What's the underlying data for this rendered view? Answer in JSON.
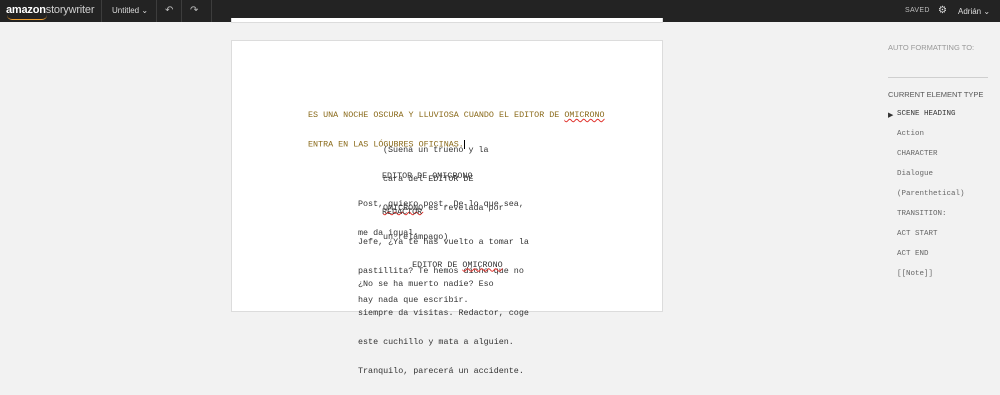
{
  "topbar": {
    "logo_bold": "amazon",
    "logo_light": "storywriter",
    "title_label": "Untitled",
    "title_caret": "⌄",
    "undo_icon": "↶",
    "redo_icon": "↷",
    "status": "SAVED",
    "settings_icon": "⚙",
    "user_name": "Adrián",
    "user_caret": "⌄"
  },
  "script": {
    "scene": [
      "ES UNA NOCHE OSCURA Y LLUVIOSA CUANDO EL EDITOR DE ",
      "OMICRONO",
      "",
      "ENTRA EN LAS LÓGUBRES OFICINAS."
    ],
    "paren": [
      "(Suena un trueno y la",
      "cara del EDITOR DE",
      "OMICRONO",
      " es revelada por",
      "un relámpago)"
    ],
    "char1": "EDITOR DE OMICRONO",
    "dial1": [
      "Post, quiero post. De lo que sea,",
      "me da igual."
    ],
    "char2": "REDACTOR",
    "dial2": [
      "Jefe, ¿Ya te has vuelto a tomar la",
      "pastillita? Te hemos dicho que no",
      "hay nada que escribir."
    ],
    "char3_a": "EDITOR DE ",
    "char3_b": "OMICRONO",
    "dial3": [
      "¿No se ha muerto nadie? Eso",
      "siempre da visitas. Redactor, coge",
      "este cuchillo y mata a alguien.",
      "Tranquilo, parecerá un accidente."
    ]
  },
  "sidebar": {
    "auto_formatting": "AUTO FORMATTING TO:",
    "current_element": "CURRENT ELEMENT TYPE",
    "selected_arrow": "▶",
    "items": [
      "SCENE HEADING",
      "Action",
      "CHARACTER",
      "Dialogue",
      "(Parenthetical)",
      "TRANSITION:",
      "ACT START",
      "ACT END",
      "[[Note]]"
    ]
  },
  "colors": {
    "topbar_bg": "#232323",
    "accent_orange": "#f0a030",
    "spell_error": "#e0302a"
  }
}
